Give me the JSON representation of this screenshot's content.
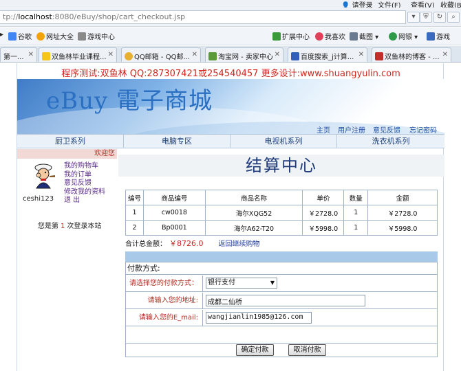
{
  "browser": {
    "menu": {
      "login": "请登录",
      "file": "文件(F)",
      "view": "查看(V)",
      "favorites": "收藏(B)"
    },
    "url_prefix": "tp://",
    "url_host": "localhost",
    "url_rest": ":8080/eBuy/shop/cart_checkout.jsp",
    "favorites_bar": [
      {
        "label": "谷歌",
        "icon": "google-icon"
      },
      {
        "label": "网址大全",
        "icon": "web-directory-icon"
      },
      {
        "label": "游戏中心",
        "icon": "gamepad-icon"
      },
      {
        "label": "扩展中心",
        "icon": "extension-icon"
      },
      {
        "label": "我喜欢",
        "icon": "heart-icon"
      },
      {
        "label": "截图",
        "icon": "scissors-icon"
      },
      {
        "label": "网银",
        "icon": "bank-icon"
      },
      {
        "label": "游戏",
        "icon": "game-icon"
      }
    ],
    "tabs": [
      {
        "label": "第一..."
      },
      {
        "label": "双鱼林毕业课程..."
      },
      {
        "label": "QQ邮箱 - QQ邮..."
      },
      {
        "label": "淘宝网 - 卖家中心"
      },
      {
        "label": "百度搜索_j计算..."
      },
      {
        "label": "双鱼林的博客 - ..."
      }
    ]
  },
  "page": {
    "promo": "程序测试:双鱼林 QQ:287307421或254540457 更多设计:www.shuangyulin.com",
    "logo": "eBuy 電子商城",
    "top_links": [
      "主页",
      "用户注册",
      "意见反馈",
      "忘记密码"
    ],
    "categories": [
      "厨卫系列",
      "电脑专区",
      "电视机系列",
      "洗衣机系列"
    ],
    "sidebar": {
      "welcome": "欢迎您",
      "username": "ceshi123",
      "links": [
        "我的购物车",
        "我的订单",
        "意见反馈",
        "修改我的资料",
        "退 出"
      ],
      "visitor_prefix": "您是第",
      "visitor_number": "1",
      "visitor_suffix": "次登录本站"
    },
    "main": {
      "title": "结算中心",
      "table_headers": [
        "编号",
        "商品编号",
        "商品名称",
        "单价",
        "数量",
        "金额"
      ],
      "rows": [
        [
          "1",
          "cw0018",
          "海尔XQG52",
          "￥2728.0",
          "1",
          "￥2728.0"
        ],
        [
          "2",
          "Bp0001",
          "海尔A62-T20",
          "￥5998.0",
          "1",
          "￥5998.0"
        ]
      ],
      "total_label": "合计总金额：",
      "total_amount": "￥8726.0",
      "continue_link": "返回继续购物",
      "payment_heading": "付款方式:",
      "payment_label": "请选择您的付款方式：",
      "payment_value": "银行支付",
      "address_label": "请输入您的地址:",
      "address_value": "成都二仙桥",
      "email_label": "请输入您的E_mail:",
      "email_value": "wangjianlin1985@126.com",
      "confirm_button": "确定付款",
      "cancel_button": "取消付款"
    }
  }
}
